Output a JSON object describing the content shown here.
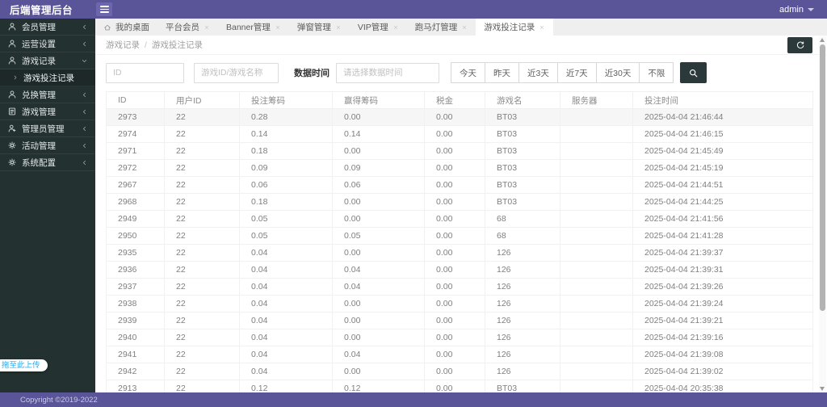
{
  "header": {
    "title": "后端管理后台",
    "user": "admin"
  },
  "sidebar": {
    "items": [
      {
        "label": "会员管理",
        "icon": "user",
        "state": "collapsed"
      },
      {
        "label": "运营设置",
        "icon": "user",
        "state": "collapsed"
      },
      {
        "label": "游戏记录",
        "icon": "user",
        "state": "expanded",
        "children": [
          {
            "label": "游戏投注记录",
            "active": true
          }
        ]
      },
      {
        "label": "兑换管理",
        "icon": "user",
        "state": "collapsed"
      },
      {
        "label": "游戏管理",
        "icon": "document",
        "state": "collapsed"
      },
      {
        "label": "管理员管理",
        "icon": "admin-user",
        "state": "collapsed"
      },
      {
        "label": "活动管理",
        "icon": "gear",
        "state": "collapsed"
      },
      {
        "label": "系统配置",
        "icon": "gear",
        "state": "collapsed"
      }
    ],
    "upload_hint": "拖至此上传"
  },
  "tabs": [
    {
      "label": "我的桌面",
      "icon": "home",
      "closable": false,
      "active": false
    },
    {
      "label": "平台会员",
      "closable": true,
      "active": false
    },
    {
      "label": "Banner管理",
      "closable": true,
      "active": false
    },
    {
      "label": "弹窗管理",
      "closable": true,
      "active": false
    },
    {
      "label": "VIP管理",
      "closable": true,
      "active": false
    },
    {
      "label": "跑马灯管理",
      "closable": true,
      "active": false
    },
    {
      "label": "游戏投注记录",
      "closable": true,
      "active": true
    }
  ],
  "breadcrumb": {
    "parent": "游戏记录",
    "separator": "/",
    "current": "游戏投注记录"
  },
  "filters": {
    "id_placeholder": "ID",
    "game_placeholder": "游戏ID/游戏名称",
    "date_label": "数据时间",
    "date_placeholder": "请选择数据时间",
    "quick_buttons": [
      "今天",
      "昨天",
      "近3天",
      "近7天",
      "近30天",
      "不限"
    ]
  },
  "table": {
    "columns": [
      "ID",
      "用户ID",
      "投注筹码",
      "赢得筹码",
      "税金",
      "游戏名",
      "服务器",
      "投注时间"
    ],
    "rows": [
      [
        "2973",
        "22",
        "0.28",
        "0.00",
        "0.00",
        "BT03",
        "",
        "2025-04-04 21:46:44"
      ],
      [
        "2974",
        "22",
        "0.14",
        "0.14",
        "0.00",
        "BT03",
        "",
        "2025-04-04 21:46:15"
      ],
      [
        "2971",
        "22",
        "0.18",
        "0.00",
        "0.00",
        "BT03",
        "",
        "2025-04-04 21:45:49"
      ],
      [
        "2972",
        "22",
        "0.09",
        "0.09",
        "0.00",
        "BT03",
        "",
        "2025-04-04 21:45:19"
      ],
      [
        "2967",
        "22",
        "0.06",
        "0.06",
        "0.00",
        "BT03",
        "",
        "2025-04-04 21:44:51"
      ],
      [
        "2968",
        "22",
        "0.18",
        "0.00",
        "0.00",
        "BT03",
        "",
        "2025-04-04 21:44:25"
      ],
      [
        "2949",
        "22",
        "0.05",
        "0.00",
        "0.00",
        "68",
        "",
        "2025-04-04 21:41:56"
      ],
      [
        "2950",
        "22",
        "0.05",
        "0.05",
        "0.00",
        "68",
        "",
        "2025-04-04 21:41:28"
      ],
      [
        "2935",
        "22",
        "0.04",
        "0.00",
        "0.00",
        "126",
        "",
        "2025-04-04 21:39:37"
      ],
      [
        "2936",
        "22",
        "0.04",
        "0.04",
        "0.00",
        "126",
        "",
        "2025-04-04 21:39:31"
      ],
      [
        "2937",
        "22",
        "0.04",
        "0.04",
        "0.00",
        "126",
        "",
        "2025-04-04 21:39:26"
      ],
      [
        "2938",
        "22",
        "0.04",
        "0.00",
        "0.00",
        "126",
        "",
        "2025-04-04 21:39:24"
      ],
      [
        "2939",
        "22",
        "0.04",
        "0.00",
        "0.00",
        "126",
        "",
        "2025-04-04 21:39:21"
      ],
      [
        "2940",
        "22",
        "0.04",
        "0.00",
        "0.00",
        "126",
        "",
        "2025-04-04 21:39:16"
      ],
      [
        "2941",
        "22",
        "0.04",
        "0.04",
        "0.00",
        "126",
        "",
        "2025-04-04 21:39:08"
      ],
      [
        "2942",
        "22",
        "0.04",
        "0.00",
        "0.00",
        "126",
        "",
        "2025-04-04 21:39:02"
      ],
      [
        "2913",
        "22",
        "0.12",
        "0.12",
        "0.00",
        "BT03",
        "",
        "2025-04-04 20:35:38"
      ]
    ]
  },
  "footer": {
    "copyright": "Copyright ©2019-2022"
  },
  "colors": {
    "primary": "#5a5499",
    "sidebar_bg": "#233130",
    "dark_button": "#2b393b",
    "upload_link": "#2ba7ea",
    "shaded_row": "#f6f6f6"
  }
}
